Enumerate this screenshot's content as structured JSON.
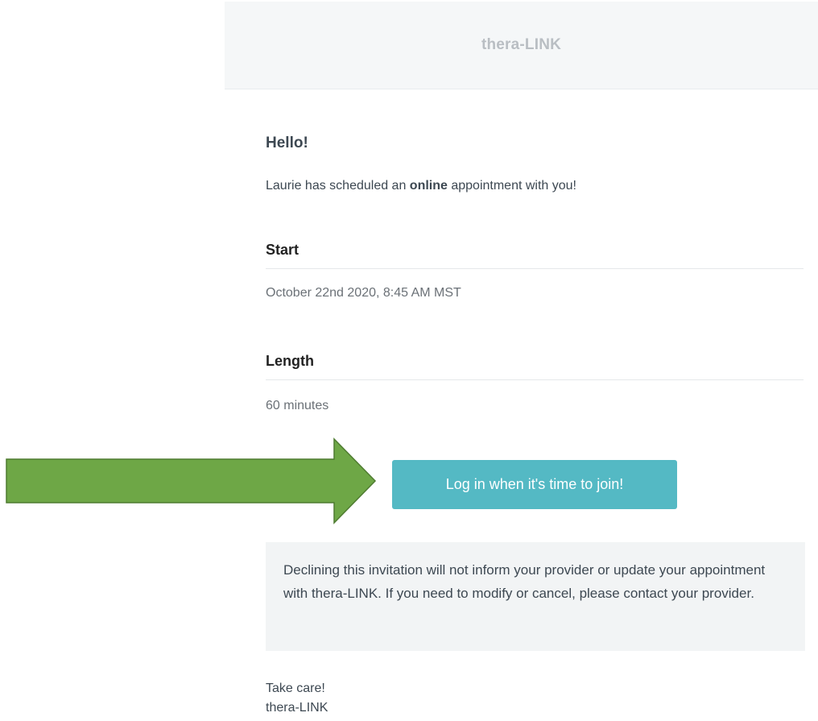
{
  "header": {
    "brand": "thera-LINK"
  },
  "email": {
    "greeting": "Hello!",
    "intro_before": "Laurie has scheduled an ",
    "intro_bold": "online",
    "intro_after": " appointment with you!",
    "start_label": "Start",
    "start_value": "October 22nd 2020, 8:45 AM MST",
    "length_label": "Length",
    "length_value": "60 minutes",
    "join_button_label": "Log in when it's time to join!",
    "notice_text": "Declining this invitation will not inform your provider or update your appointment with thera-LINK. If you need to modify or cancel, please contact your provider.",
    "signoff_line1": "Take care!",
    "signoff_line2": "thera-LINK"
  },
  "colors": {
    "button": "#54b9c4",
    "arrow_fill": "#6ea746",
    "arrow_stroke": "#4f7c31",
    "header_bg": "#f5f7f8",
    "notice_bg": "#f2f4f5"
  },
  "annotation": {
    "arrow_icon": "right-arrow-icon"
  }
}
